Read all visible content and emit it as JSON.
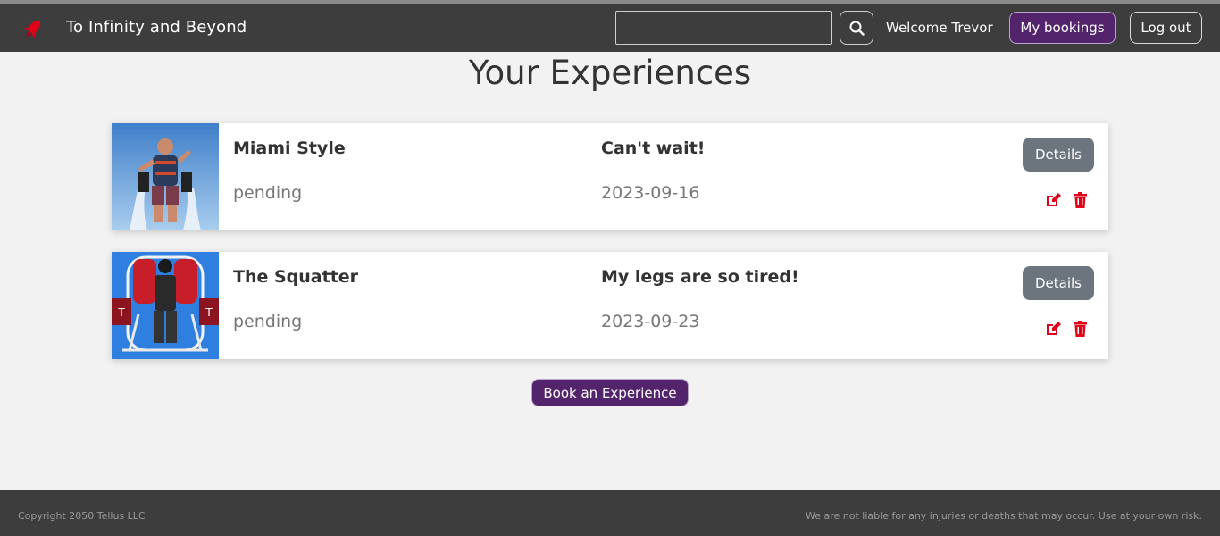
{
  "header": {
    "brand_title": "To Infinity and Beyond",
    "brand_icon": "rocket-icon",
    "search_value": "",
    "search_icon": "magnifier-icon",
    "welcome_text": "Welcome Trevor",
    "bookings_label": "My bookings",
    "logout_label": "Log out"
  },
  "main": {
    "title": "Your Experiences",
    "book_label": "Book an Experience"
  },
  "experiences": [
    {
      "name": "Miami Style",
      "status": "pending",
      "note": "Can't wait!",
      "date": "2023-09-16",
      "details_label": "Details"
    },
    {
      "name": "The Squatter",
      "status": "pending",
      "note": "My legs are so tired!",
      "date": "2023-09-23",
      "details_label": "Details"
    }
  ],
  "footer": {
    "copyright": "Copyright 2050 Tellus LLC",
    "disclaimer": "We are not liable for any injuries or deaths that may occur. Use at your own risk."
  },
  "colors": {
    "navbar": "#3d3d3d",
    "accent_purple": "#53246b",
    "details_gray": "#6c757d",
    "icon_red": "#e0001a",
    "background": "#f2f2f2"
  }
}
